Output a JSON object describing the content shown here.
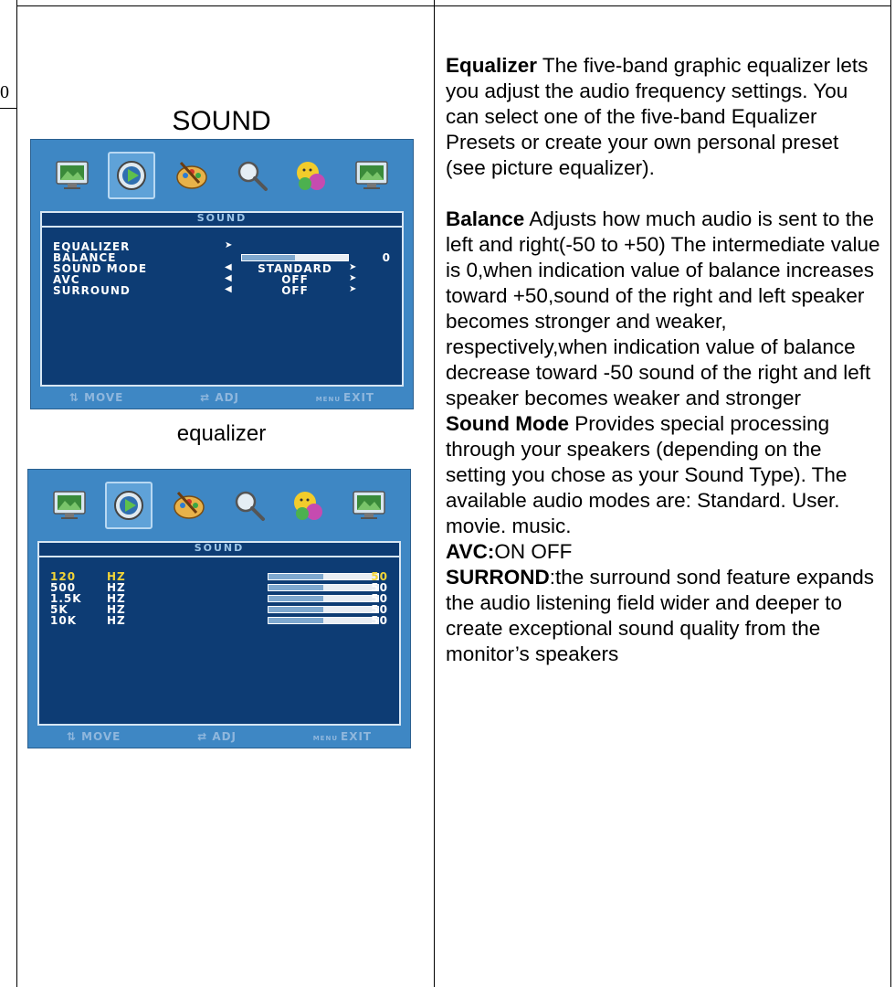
{
  "page_number": "0",
  "sound_caption": "SOUND",
  "equalizer_caption": "equalizer",
  "osd_sound": {
    "panel_title": "SOUND",
    "rows": [
      {
        "label": "EQUALIZER",
        "value": "",
        "num": ""
      },
      {
        "label": "BALANCE",
        "value": "",
        "num": "0"
      },
      {
        "label": "SOUND MODE",
        "value": "STANDARD",
        "num": ""
      },
      {
        "label": "AVC",
        "value": "OFF",
        "num": ""
      },
      {
        "label": "SURROUND",
        "value": "OFF",
        "num": ""
      }
    ],
    "balance_level": 0.5,
    "footer": {
      "move": "MOVE",
      "adj": "ADJ",
      "menu": "MENU",
      "exit": "EXIT"
    }
  },
  "osd_equalizer": {
    "panel_title": "SOUND",
    "bands": [
      {
        "freq": "120",
        "unit": "HZ",
        "value": "50",
        "level": 0.5
      },
      {
        "freq": "500",
        "unit": "HZ",
        "value": "50",
        "level": 0.5
      },
      {
        "freq": "1.5K",
        "unit": "HZ",
        "value": "50",
        "level": 0.5
      },
      {
        "freq": "5K",
        "unit": "HZ",
        "value": "50",
        "level": 0.5
      },
      {
        "freq": "10K",
        "unit": "HZ",
        "value": "50",
        "level": 0.5
      }
    ],
    "footer": {
      "move": "MOVE",
      "adj": "ADJ",
      "menu": "MENU",
      "exit": "EXIT"
    }
  },
  "osd_icons": [
    "picture-icon",
    "sound-icon",
    "palette-icon",
    "magnifier-icon",
    "faces-icon",
    "monitor-icon"
  ],
  "description": {
    "equalizer_title": "Equalizer",
    "equalizer_text": " The five-band graphic equalizer lets you adjust the audio frequency settings. You can select one of the five-band Equalizer Presets or create your own personal preset (see picture equalizer).",
    "balance_title": "Balance",
    "balance_text": "  Adjusts how much audio is sent to the left and right(-50 to  +50) The intermediate value is 0,when indication value of balance increases toward +50,sound of the right and left speaker becomes stronger and weaker, respectively,when indication value of balance decrease toward -50 sound of the right and left speaker becomes weaker and stronger",
    "sound_mode_title": "Sound Mode",
    "sound_mode_text": "   Provides special processing through your speakers (depending on the setting you chose as your Sound Type). The available audio modes are: Standard. User. movie. music.",
    "avc_title": "AVC:",
    "avc_text": "ON  OFF",
    "surround_title": "SURROND",
    "surround_text": ":the surround sond feature expands the audio listening field wider and deeper to create exceptional sound quality from the monitor’s speakers"
  }
}
